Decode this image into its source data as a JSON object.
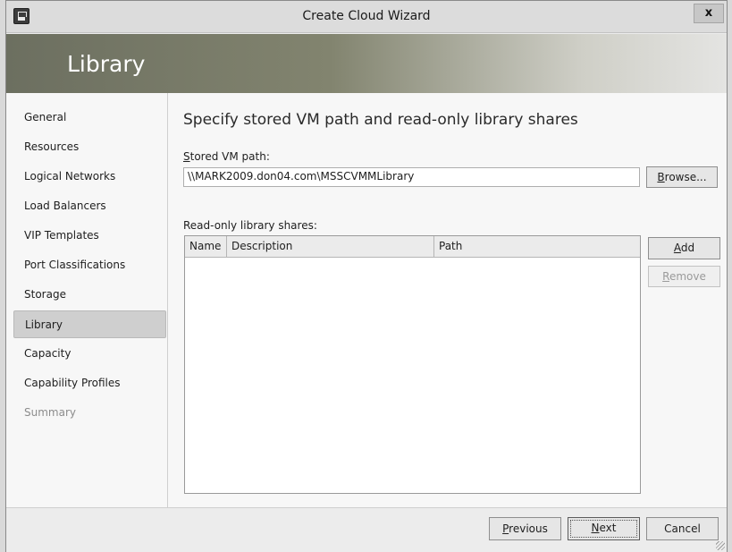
{
  "window": {
    "title": "Create Cloud Wizard",
    "close_label": "x"
  },
  "header": {
    "page_title": "Library"
  },
  "nav": {
    "items": [
      {
        "label": "General",
        "state": "normal"
      },
      {
        "label": "Resources",
        "state": "normal"
      },
      {
        "label": "Logical Networks",
        "state": "normal"
      },
      {
        "label": "Load Balancers",
        "state": "normal"
      },
      {
        "label": "VIP Templates",
        "state": "normal"
      },
      {
        "label": "Port Classifications",
        "state": "normal"
      },
      {
        "label": "Storage",
        "state": "normal"
      },
      {
        "label": "Library",
        "state": "selected"
      },
      {
        "label": "Capacity",
        "state": "normal"
      },
      {
        "label": "Capability Profiles",
        "state": "normal"
      },
      {
        "label": "Summary",
        "state": "disabled"
      }
    ]
  },
  "main": {
    "heading": "Specify stored VM path and read-only library shares",
    "stored_vm_path": {
      "label_accel": "S",
      "label_rest": "tored VM path:",
      "value": "\\\\MARK2009.don04.com\\MSSCVMMLibrary"
    },
    "browse_button": {
      "accel": "B",
      "rest": "rowse..."
    },
    "shares": {
      "label": "Read-only library shares:",
      "columns": [
        "Name",
        "Description",
        "Path"
      ],
      "rows": []
    },
    "add_button": {
      "accel": "A",
      "rest": "dd"
    },
    "remove_button": {
      "accel": "R",
      "rest": "emove",
      "enabled": false
    }
  },
  "footer": {
    "previous_button": {
      "accel": "P",
      "rest": "revious"
    },
    "next_button": {
      "accel": "N",
      "rest": "ext"
    },
    "cancel_button": "Cancel"
  },
  "colors": {
    "header_band_start": "#6c6f60",
    "header_band_end": "#e4e4e2",
    "selected_nav": "#cfcfcf",
    "disabled_text": "#8c8c8c"
  }
}
